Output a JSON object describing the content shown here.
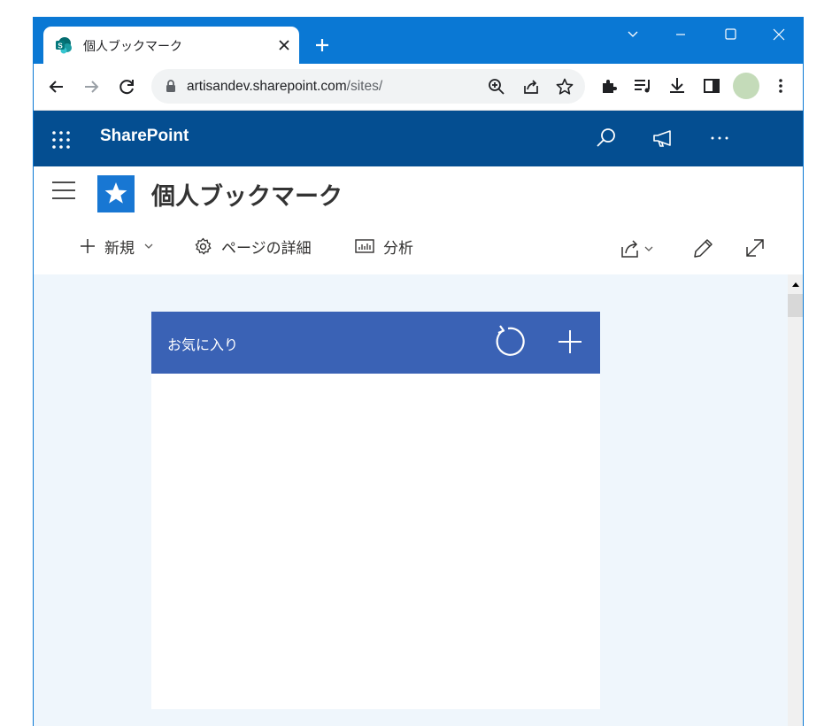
{
  "browser": {
    "tab": {
      "title": "個人ブックマーク",
      "favicon": "sharepoint-favicon",
      "close_icon": "close-icon"
    },
    "new_tab_icon": "plus-icon",
    "window_controls": [
      "chevron-down-icon",
      "minimize-icon",
      "maximize-icon",
      "close-icon"
    ],
    "address": {
      "host": "artisandev.sharepoint.com",
      "path": "/sites/"
    },
    "colors": {
      "tabstrip": "#0a78d4",
      "omnibox": "#f1f3f4",
      "avatar": "#c4dbb9"
    }
  },
  "suitebar": {
    "brand": "SharePoint",
    "icons": [
      "app-launcher-icon",
      "search-icon",
      "megaphone-icon",
      "more-icon"
    ],
    "color": "#044e91"
  },
  "site": {
    "title": "個人ブックマーク",
    "logo_icon": "star-icon",
    "commands": {
      "new": "新規",
      "page_details": "ページの詳細",
      "analytics": "分析"
    },
    "logo_color": "#1877d3"
  },
  "webpart": {
    "title": "お気に入り",
    "icons": [
      "refresh-icon",
      "add-icon"
    ],
    "header_color": "#3a62b5"
  },
  "content_background": "#eff6fc"
}
